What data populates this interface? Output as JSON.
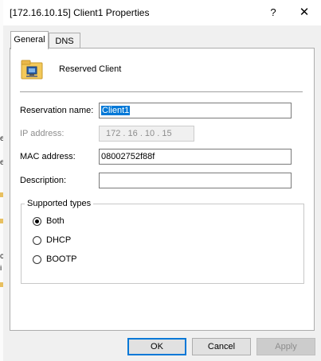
{
  "window": {
    "title": "[172.16.10.15] Client1 Properties",
    "help_glyph": "?",
    "close_glyph": "✕"
  },
  "tabs": [
    {
      "label": "General",
      "selected": true
    },
    {
      "label": "DNS",
      "selected": false
    }
  ],
  "header": {
    "icon": "reserved-client-icon",
    "label": "Reserved Client"
  },
  "form": {
    "reservation_name": {
      "label": "Reservation name:",
      "value": "Client1"
    },
    "ip_address": {
      "label": "IP address:",
      "value": "172 . 16 . 10 . 15"
    },
    "mac_address": {
      "label": "MAC address:",
      "value": "08002752f88f"
    },
    "description": {
      "label": "Description:",
      "value": ""
    }
  },
  "supported_types": {
    "label": "Supported types",
    "options": [
      {
        "label": "Both",
        "selected": true
      },
      {
        "label": "DHCP",
        "selected": false
      },
      {
        "label": "BOOTP",
        "selected": false
      }
    ]
  },
  "buttons": {
    "ok": "OK",
    "cancel": "Cancel",
    "apply": "Apply"
  },
  "colors": {
    "accent": "#0078d7",
    "disabled_text": "#8d8d8d"
  }
}
